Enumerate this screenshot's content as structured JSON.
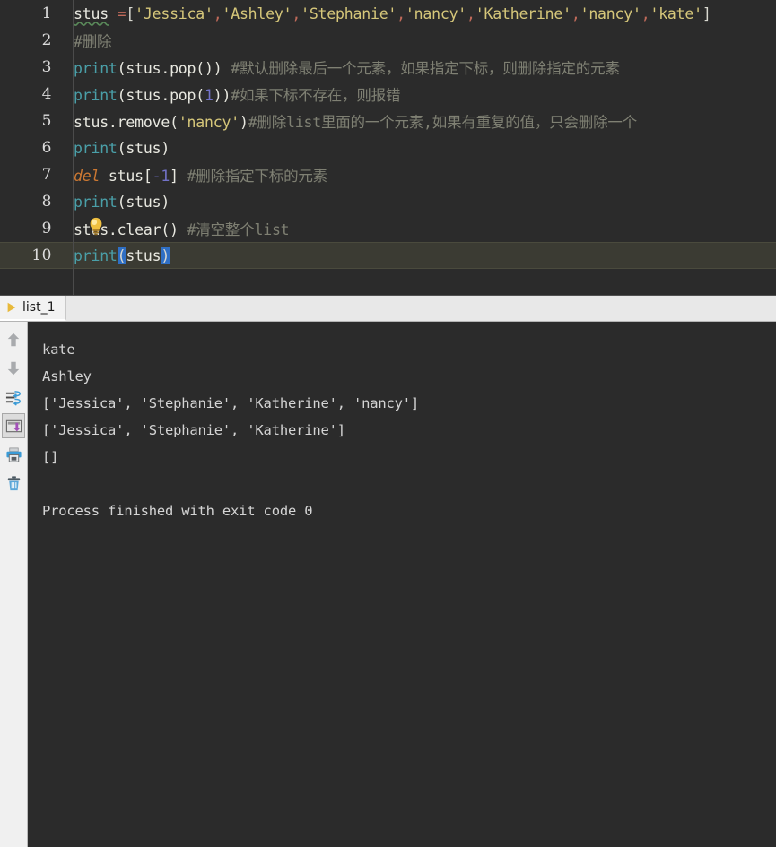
{
  "editor": {
    "current_line": 10,
    "lines": [
      {
        "num": "1",
        "tokens": [
          {
            "t": "stus",
            "c": "tok-squiggle"
          },
          {
            "t": " ",
            "c": "tok-default"
          },
          {
            "t": "=",
            "c": "tok-operator"
          },
          {
            "t": "[",
            "c": "tok-punc"
          },
          {
            "t": "'Jessica'",
            "c": "tok-string"
          },
          {
            "t": ",",
            "c": "tok-operator"
          },
          {
            "t": "'Ashley'",
            "c": "tok-string"
          },
          {
            "t": ",",
            "c": "tok-operator"
          },
          {
            "t": "'Stephanie'",
            "c": "tok-string"
          },
          {
            "t": ",",
            "c": "tok-operator"
          },
          {
            "t": "'nancy'",
            "c": "tok-string"
          },
          {
            "t": ",",
            "c": "tok-operator"
          },
          {
            "t": "'Katherine'",
            "c": "tok-string"
          },
          {
            "t": ",",
            "c": "tok-operator"
          },
          {
            "t": "'nancy'",
            "c": "tok-string"
          },
          {
            "t": ",",
            "c": "tok-operator"
          },
          {
            "t": "'kate'",
            "c": "tok-string"
          },
          {
            "t": "]",
            "c": "tok-punc"
          }
        ]
      },
      {
        "num": "2",
        "tokens": [
          {
            "t": "#删除",
            "c": "tok-comment"
          }
        ]
      },
      {
        "num": "3",
        "tokens": [
          {
            "t": "print",
            "c": "tok-func"
          },
          {
            "t": "(stus.pop())",
            "c": "tok-ident"
          },
          {
            "t": " ",
            "c": "tok-default"
          },
          {
            "t": "#默认删除最后一个元素，如果指定下标，则删除指定的元素",
            "c": "tok-comment"
          }
        ]
      },
      {
        "num": "4",
        "tokens": [
          {
            "t": "print",
            "c": "tok-func"
          },
          {
            "t": "(stus.pop(",
            "c": "tok-ident"
          },
          {
            "t": "1",
            "c": "tok-number"
          },
          {
            "t": "))",
            "c": "tok-ident"
          },
          {
            "t": "#如果下标不存在，则报错",
            "c": "tok-comment"
          }
        ]
      },
      {
        "num": "5",
        "tokens": [
          {
            "t": "stus.remove(",
            "c": "tok-ident"
          },
          {
            "t": "'nancy'",
            "c": "tok-string"
          },
          {
            "t": ")",
            "c": "tok-ident"
          },
          {
            "t": "#删除list里面的一个元素,如果有重复的值，只会删除一个",
            "c": "tok-comment"
          }
        ]
      },
      {
        "num": "6",
        "tokens": [
          {
            "t": "print",
            "c": "tok-func"
          },
          {
            "t": "(stus)",
            "c": "tok-ident"
          }
        ]
      },
      {
        "num": "7",
        "tokens": [
          {
            "t": "del",
            "c": "tok-keyword"
          },
          {
            "t": " stus[",
            "c": "tok-ident"
          },
          {
            "t": "-1",
            "c": "tok-number"
          },
          {
            "t": "]",
            "c": "tok-ident"
          },
          {
            "t": " ",
            "c": "tok-default"
          },
          {
            "t": "#删除指定下标的元素",
            "c": "tok-comment"
          }
        ]
      },
      {
        "num": "8",
        "tokens": [
          {
            "t": "print",
            "c": "tok-func"
          },
          {
            "t": "(stus)",
            "c": "tok-ident"
          }
        ]
      },
      {
        "num": "9",
        "tokens": [
          {
            "t": "stus.clear()",
            "c": "tok-ident"
          },
          {
            "t": " ",
            "c": "tok-default"
          },
          {
            "t": "#清空整个list",
            "c": "tok-comment"
          }
        ]
      },
      {
        "num": "10",
        "tokens": [
          {
            "t": "print",
            "c": "tok-func"
          },
          {
            "t": "(",
            "c": "tok-sel"
          },
          {
            "t": "stus",
            "c": "tok-ident"
          },
          {
            "t": ")",
            "c": "tok-sel"
          }
        ]
      }
    ]
  },
  "console": {
    "tab_label": "list_1",
    "tab_icon": "python-run-icon",
    "toolbar": [
      {
        "name": "scroll-up-button",
        "icon": "arrow-up-icon",
        "pressed": false
      },
      {
        "name": "scroll-down-button",
        "icon": "arrow-down-icon",
        "pressed": false
      },
      {
        "name": "soft-wrap-button",
        "icon": "soft-wrap-icon",
        "pressed": false
      },
      {
        "name": "scroll-to-end-button",
        "icon": "scroll-to-end-icon",
        "pressed": true
      },
      {
        "name": "print-button",
        "icon": "printer-icon",
        "pressed": false
      },
      {
        "name": "clear-all-button",
        "icon": "trash-icon",
        "pressed": false
      }
    ],
    "output_lines": [
      "kate",
      "Ashley",
      "['Jessica', 'Stephanie', 'Katherine', 'nancy']",
      "['Jessica', 'Stephanie', 'Katherine']",
      "[]",
      "",
      "Process finished with exit code 0"
    ]
  },
  "colors": {
    "editor_bg": "#2b2b2b",
    "current_line_bg": "#3b3b33",
    "string": "#d6c77a",
    "comment": "#7f8073",
    "function": "#4a9fa8",
    "keyword": "#cc7832",
    "number": "#7272c8",
    "selection": "#2f6fc4",
    "tabbar_bg": "#e8e8e8",
    "toolbar_bg": "#f0f0f0"
  }
}
